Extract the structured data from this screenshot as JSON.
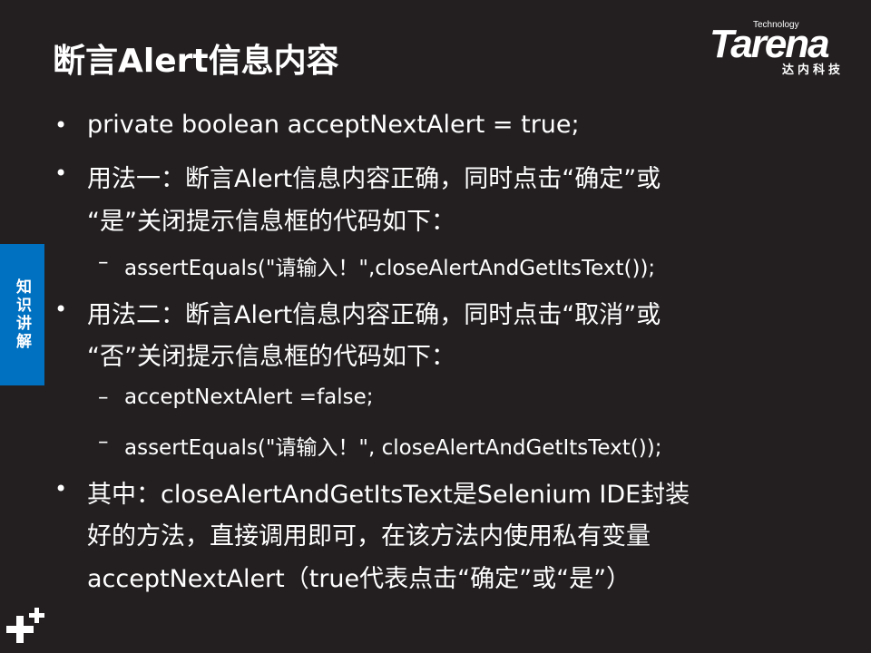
{
  "title": "断言Alert信息内容",
  "logo": {
    "brand": "Tarena",
    "tagline": "Technology",
    "cn": "达内科技"
  },
  "side_tab": "知识讲解",
  "content": [
    {
      "type": "bullet",
      "lines": [
        "private boolean acceptNextAlert = true;"
      ]
    },
    {
      "type": "bullet",
      "lines": [
        "用法一：断言Alert信息内容正确，同时点击“确定”或",
        "“是”关闭提示信息框的代码如下："
      ]
    },
    {
      "type": "sub",
      "lines": [
        "assertEquals(\"请输入！\",closeAlertAndGetItsText());"
      ]
    },
    {
      "type": "bullet",
      "lines": [
        "用法二：断言Alert信息内容正确，同时点击“取消”或",
        "“否”关闭提示信息框的代码如下："
      ]
    },
    {
      "type": "sub",
      "lines": [
        "acceptNextAlert =false;"
      ]
    },
    {
      "type": "sub",
      "lines": [
        "assertEquals(\"请输入！\", closeAlertAndGetItsText());"
      ]
    },
    {
      "type": "bullet",
      "lines": [
        "其中：closeAlertAndGetItsText是Selenium IDE封装",
        "好的方法，直接调用即可，在该方法内使用私有变量",
        "acceptNextAlert（true代表点击“确定”或“是”）"
      ]
    }
  ],
  "bullet_char": "•",
  "dash_char": "–"
}
